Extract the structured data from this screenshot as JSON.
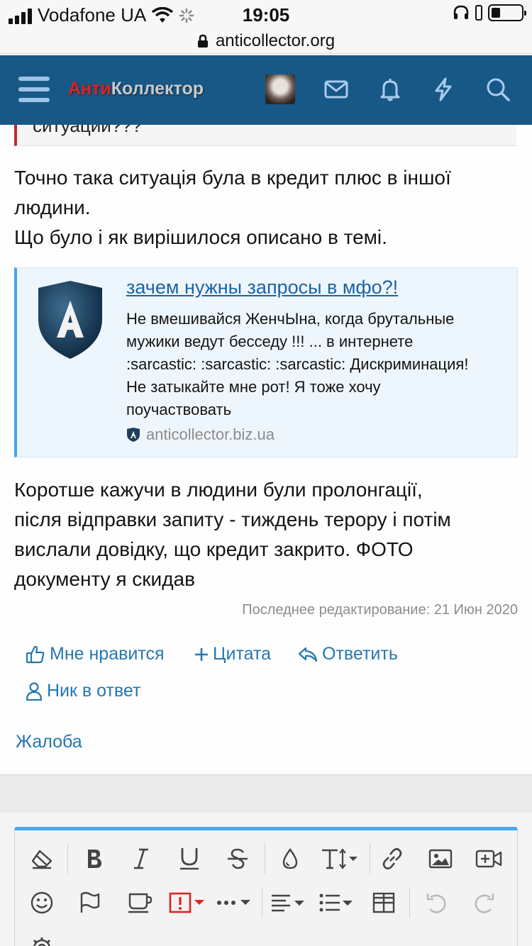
{
  "status": {
    "carrier": "Vodafone UA",
    "time": "19:05",
    "battery_level": 0.3
  },
  "browser": {
    "url": "anticollector.org"
  },
  "site": {
    "logo_red": "Анти",
    "logo_gray": "Коллектор",
    "icons": [
      "menu-icon",
      "avatar",
      "inbox-icon",
      "bell-icon",
      "bolt-icon",
      "search-icon"
    ]
  },
  "post": {
    "quote_tail": "ситуации???",
    "paragraph1_line1": "Точно така ситуація була в кредит плюс в іншої",
    "paragraph1_line2": "людини.",
    "paragraph1_line3": "Що було і як вирішилося описано в темі.",
    "unfurl": {
      "title": "зачем нужны запросы в мфо?!",
      "desc_line1": "Не вмешивайся ЖенчЫна, когда брутальные",
      "desc_line2": "мужики ведут бесседу !!! ... в интернете",
      "desc_line3": ":sarcastic: :sarcastic: :sarcastic: Дискриминация!",
      "desc_line4": "Не затыкайте мне рот! Я тоже хочу",
      "desc_line5": "поучаствовать",
      "domain": "anticollector.biz.ua"
    },
    "paragraph2_line1": "Коротше кажучи в людини були пролонгації,",
    "paragraph2_line2": "після відправки запиту - тиждень терору і потім",
    "paragraph2_line3": "вислали довідку, що кредит закрито. ФОТО",
    "paragraph2_line4": "документу я скидав",
    "last_edited": "Последнее редактирование: 21 Июн 2020"
  },
  "actions": {
    "like": "Мне нравится",
    "quote": "Цитата",
    "reply": "Ответить",
    "mention": "Ник в ответ",
    "report": "Жалоба"
  },
  "editor": {
    "row1": [
      "eraser-icon",
      "bold-icon",
      "italic-icon",
      "underline-icon",
      "strikethrough-icon",
      "color-drop-icon",
      "text-size-icon",
      "link-icon",
      "image-icon",
      "media-icon"
    ],
    "row2": [
      "smiley-icon",
      "flag-icon",
      "cup-icon",
      "spoiler-icon",
      "more-icon",
      "align-icon",
      "list-icon",
      "table-icon",
      "undo-icon",
      "redo-icon"
    ],
    "row3": [
      "gear-icon"
    ],
    "accent_color": "#47a7eb",
    "spoiler_color": "#e02121"
  },
  "colors": {
    "header_bg": "#185886",
    "link": "#2577b1",
    "quote_bar": "#c2272d"
  }
}
